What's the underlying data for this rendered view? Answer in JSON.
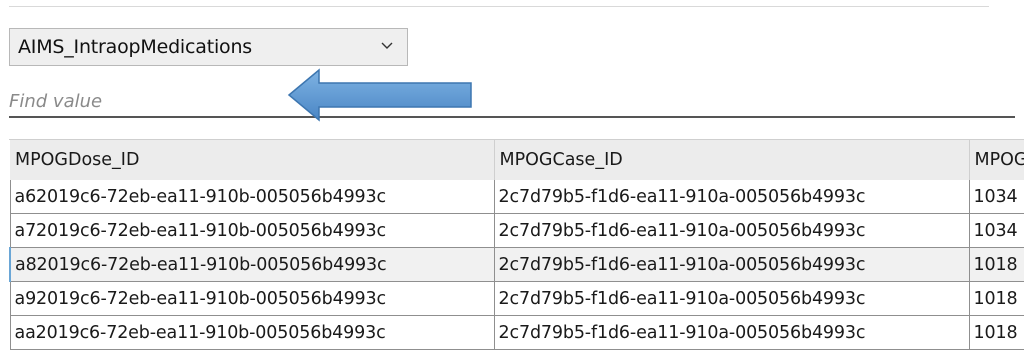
{
  "table_selector": {
    "selected": "AIMS_IntraopMedications",
    "icon": "chevron-down-icon"
  },
  "search": {
    "placeholder": "Find value"
  },
  "annotation": {
    "icon": "left-arrow-icon",
    "color": "#5b9bd5"
  },
  "grid": {
    "columns": [
      "MPOGDose_ID",
      "MPOGCase_ID",
      "MPOGPatient_ID"
    ],
    "rows": [
      [
        "a62019c6-72eb-ea11-910b-005056b4993c",
        "2c7d79b5-f1d6-ea11-910a-005056b4993c",
        "1034"
      ],
      [
        "a72019c6-72eb-ea11-910b-005056b4993c",
        "2c7d79b5-f1d6-ea11-910a-005056b4993c",
        "1034"
      ],
      [
        "a82019c6-72eb-ea11-910b-005056b4993c",
        "2c7d79b5-f1d6-ea11-910a-005056b4993c",
        "1018"
      ],
      [
        "a92019c6-72eb-ea11-910b-005056b4993c",
        "2c7d79b5-f1d6-ea11-910a-005056b4993c",
        "1018"
      ],
      [
        "aa2019c6-72eb-ea11-910b-005056b4993c",
        "2c7d79b5-f1d6-ea11-910a-005056b4993c",
        "1018"
      ]
    ],
    "selected_row": 2
  }
}
